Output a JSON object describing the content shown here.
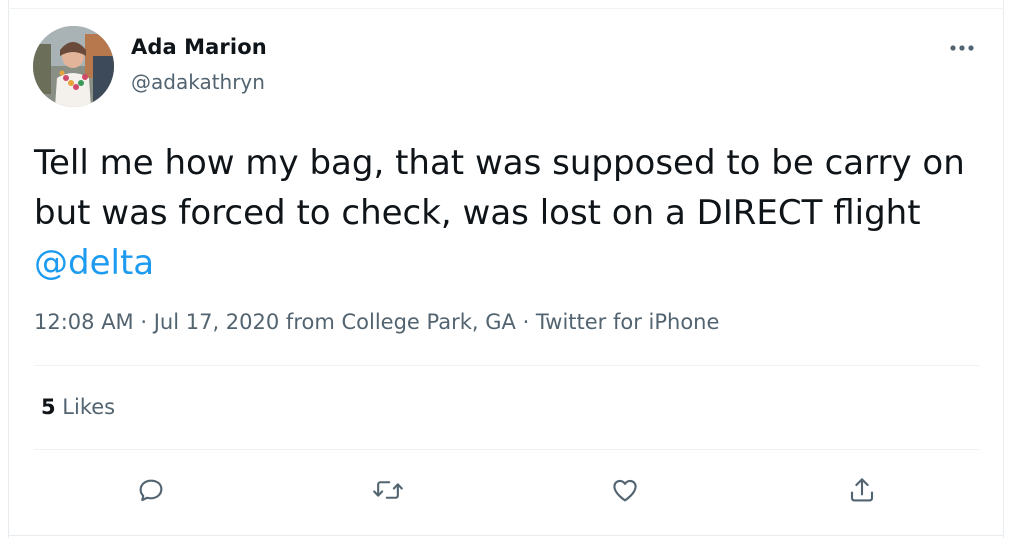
{
  "user": {
    "display_name": "Ada Marion",
    "handle": "@adakathryn"
  },
  "tweet": {
    "text": "Tell me how my bag, that was supposed to be carry on but was forced to check, was lost on a DIRECT flight ",
    "mention": "@delta",
    "time": "12:08 AM",
    "separator": " · ",
    "date": "Jul 17, 2020",
    "location_prefix": " from ",
    "location": "College Park, GA",
    "source": "Twitter for iPhone"
  },
  "stats": {
    "likes_count": "5",
    "likes_label": " Likes"
  },
  "actions": {
    "reply": "reply-icon",
    "retweet": "retweet-icon",
    "like": "heart-icon",
    "share": "share-icon"
  },
  "colors": {
    "link": "#1d9bf0",
    "text": "#0f1419",
    "secondary": "#536471",
    "divider": "#eff3f4"
  }
}
